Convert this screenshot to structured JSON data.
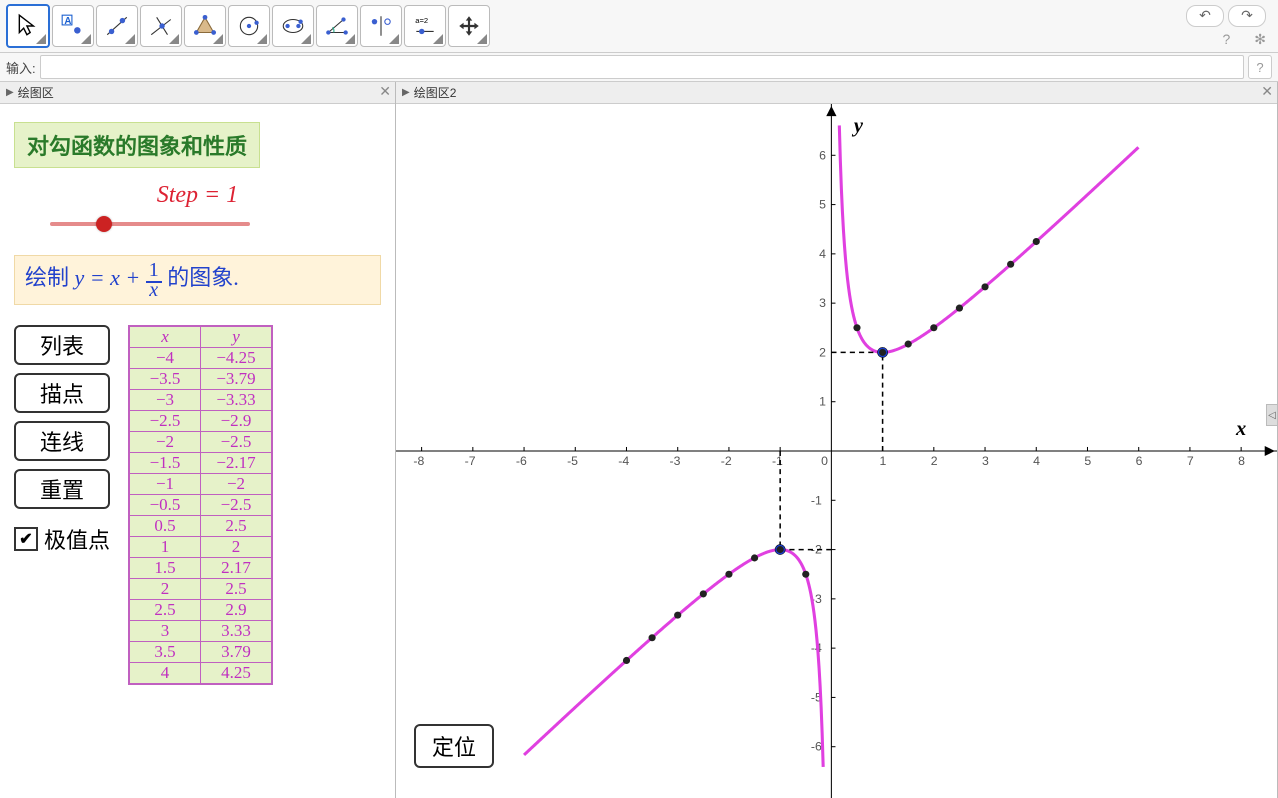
{
  "toolbar": {
    "tools": [
      "move-tool",
      "point-tool",
      "line-tool",
      "perpendicular-tool",
      "polygon-tool",
      "circle-tool",
      "ellipse-tool",
      "angle-tool",
      "reflect-tool",
      "slider-tool",
      "move-view-tool"
    ],
    "undo_glyph": "↶",
    "redo_glyph": "↷",
    "help_glyph": "?",
    "menu_glyph": "✻"
  },
  "inputbar": {
    "label": "输入:",
    "value": "",
    "help_glyph": "?"
  },
  "left": {
    "title": "绘图区",
    "heading": "对勾函数的图象和性质",
    "step": {
      "label_prefix": "Step = ",
      "value": "1",
      "min": 1,
      "max": 4,
      "pos_pct": 25
    },
    "formula": {
      "prefix": "绘制",
      "var": "y = x + ",
      "frac_num": "1",
      "frac_den": "x",
      "suffix": "的图象."
    },
    "buttons": {
      "list": "列表",
      "points": "描点",
      "connect": "连线",
      "reset": "重置"
    },
    "checkbox": {
      "label": "极值点",
      "checked": true
    },
    "table": {
      "head_x": "x",
      "head_y": "y",
      "rows": [
        {
          "x": "−4",
          "y": "−4.25"
        },
        {
          "x": "−3.5",
          "y": "−3.79"
        },
        {
          "x": "−3",
          "y": "−3.33"
        },
        {
          "x": "−2.5",
          "y": "−2.9"
        },
        {
          "x": "−2",
          "y": "−2.5"
        },
        {
          "x": "−1.5",
          "y": "−2.17"
        },
        {
          "x": "−1",
          "y": "−2"
        },
        {
          "x": "−0.5",
          "y": "−2.5"
        },
        {
          "x": "0.5",
          "y": "2.5"
        },
        {
          "x": "1",
          "y": "2"
        },
        {
          "x": "1.5",
          "y": "2.17"
        },
        {
          "x": "2",
          "y": "2.5"
        },
        {
          "x": "2.5",
          "y": "2.9"
        },
        {
          "x": "3",
          "y": "3.33"
        },
        {
          "x": "3.5",
          "y": "3.79"
        },
        {
          "x": "4",
          "y": "4.25"
        }
      ]
    }
  },
  "right": {
    "title": "绘图区2",
    "locate_btn": "定位",
    "axes": {
      "xlabel": "x",
      "ylabel": "y",
      "xtick_min": -8,
      "xtick_max": 8,
      "ytick_min": -6,
      "ytick_max": 6
    },
    "extreme_points": [
      {
        "x": 1,
        "y": 2
      },
      {
        "x": -1,
        "y": -2
      }
    ],
    "data_points": [
      {
        "x": -4,
        "y": -4.25
      },
      {
        "x": -3.5,
        "y": -3.79
      },
      {
        "x": -3,
        "y": -3.33
      },
      {
        "x": -2.5,
        "y": -2.9
      },
      {
        "x": -2,
        "y": -2.5
      },
      {
        "x": -1.5,
        "y": -2.17
      },
      {
        "x": -1,
        "y": -2
      },
      {
        "x": -0.5,
        "y": -2.5
      },
      {
        "x": 0.5,
        "y": 2.5
      },
      {
        "x": 1,
        "y": 2
      },
      {
        "x": 1.5,
        "y": 2.17
      },
      {
        "x": 2,
        "y": 2.5
      },
      {
        "x": 2.5,
        "y": 2.9
      },
      {
        "x": 3,
        "y": 3.33
      },
      {
        "x": 3.5,
        "y": 3.79
      },
      {
        "x": 4,
        "y": 4.25
      }
    ]
  },
  "chart_data": {
    "type": "line",
    "title": "y = x + 1/x",
    "xlabel": "x",
    "ylabel": "y",
    "xlim": [
      -8,
      8
    ],
    "ylim": [
      -6.5,
      6.5
    ],
    "series": [
      {
        "name": "y = x + 1/x",
        "x": [
          -4,
          -3.5,
          -3,
          -2.5,
          -2,
          -1.5,
          -1,
          -0.5,
          0.5,
          1,
          1.5,
          2,
          2.5,
          3,
          3.5,
          4
        ],
        "y": [
          -4.25,
          -3.79,
          -3.33,
          -2.9,
          -2.5,
          -2.17,
          -2,
          -2.5,
          2.5,
          2,
          2.17,
          2.5,
          2.9,
          3.33,
          3.79,
          4.25
        ]
      }
    ],
    "extrema": [
      {
        "x": 1,
        "y": 2,
        "type": "min"
      },
      {
        "x": -1,
        "y": -2,
        "type": "max"
      }
    ]
  }
}
